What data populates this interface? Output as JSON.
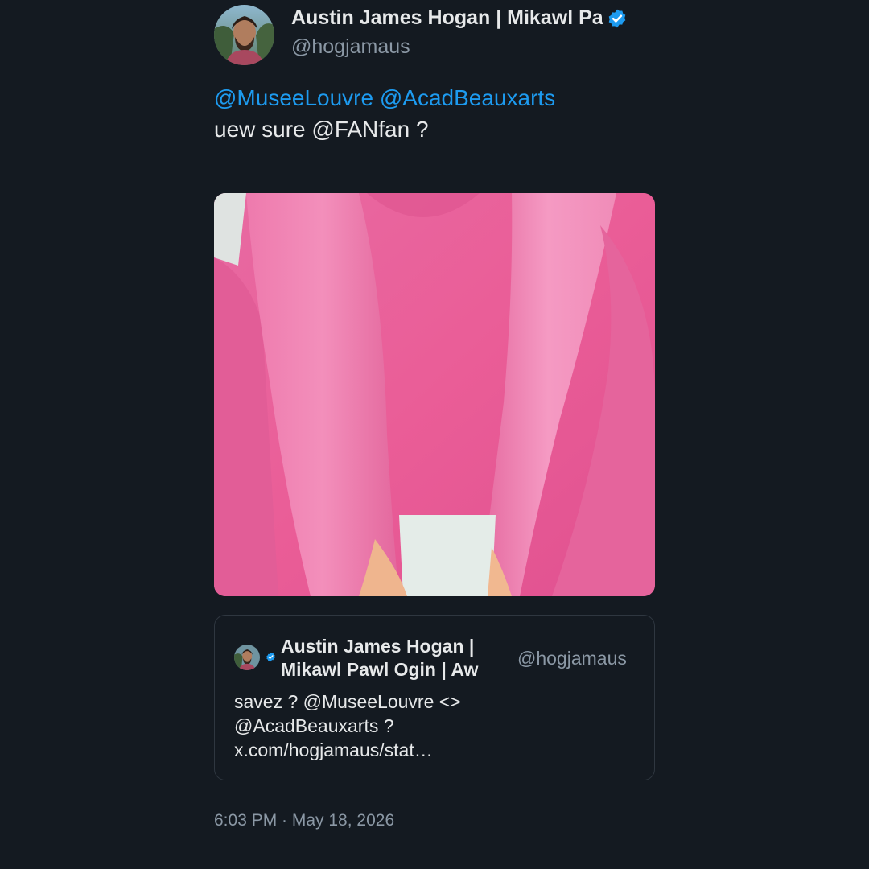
{
  "tweet": {
    "display_name": "Austin James Hogan | Mikawl Pa",
    "handle": "@hogjamaus",
    "mention_1": "@MuseeLouvre",
    "mention_2": "@AcadBeauxarts",
    "text_line_2": "uew sure @FANfan ?",
    "timestamp": "6:03 PM · May 18, 2026"
  },
  "quote": {
    "name_line_1": "Austin James Hogan |",
    "name_line_2": "Mikawl Pawl Ogin | Aw",
    "handle": "@hogjamaus",
    "text_lines": [
      "savez ? @MuseeLouvre <>",
      "@AcadBeauxarts ?",
      "x.com/hogjamaus/stat…"
    ]
  },
  "icons": {
    "verified": "verified-badge-icon",
    "avatar": "user-avatar"
  },
  "colors": {
    "background": "#141a21",
    "text": "#e7e9ea",
    "secondary_text": "#8b98a5",
    "link": "#1d9bf0",
    "verified": "#1d9bf0",
    "quote_border": "#2f3740"
  }
}
